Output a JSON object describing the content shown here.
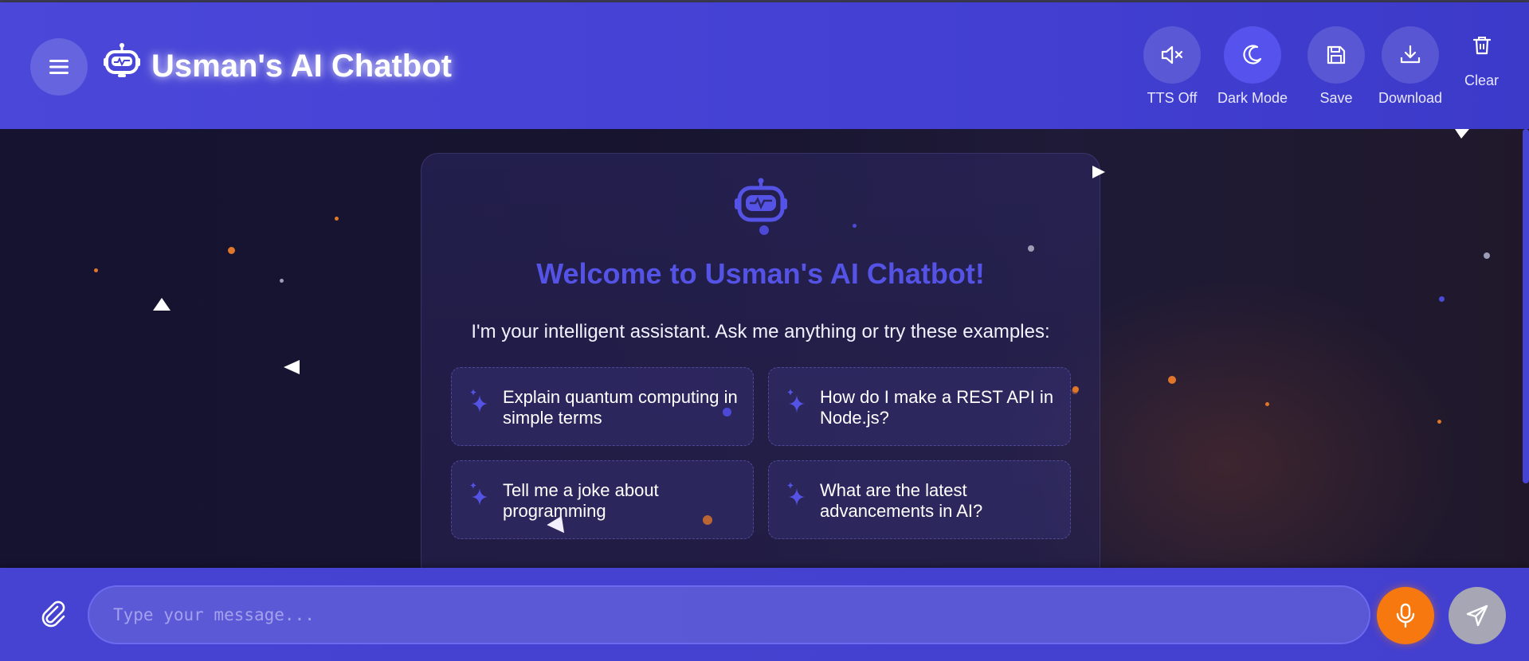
{
  "header": {
    "title": "Usman's AI Chatbot",
    "menu_icon": "hamburger-menu-icon",
    "logo_icon": "robot-icon",
    "toolbar": [
      {
        "label": "TTS Off",
        "icon": "speaker-muted-icon",
        "active": false
      },
      {
        "label": "Dark Mode",
        "icon": "moon-icon",
        "active": true
      },
      {
        "label": "Save",
        "icon": "floppy-disk-icon",
        "active": false
      },
      {
        "label": "Download",
        "icon": "download-icon",
        "active": false
      },
      {
        "label": "Clear",
        "icon": "trash-icon",
        "active": false
      }
    ]
  },
  "welcome": {
    "icon": "robot-icon",
    "title": "Welcome to Usman's AI Chatbot!",
    "subtitle": "I'm your intelligent assistant. Ask me anything or try these examples:",
    "suggestions": [
      {
        "text": "Explain quantum computing in simple terms",
        "icon": "sparkles-icon"
      },
      {
        "text": "How do I make a REST API in Node.js?",
        "icon": "sparkles-icon"
      },
      {
        "text": "Tell me a joke about programming",
        "icon": "sparkles-icon"
      },
      {
        "text": "What are the latest advancements in AI?",
        "icon": "sparkles-icon"
      }
    ]
  },
  "composer": {
    "placeholder": "Type your message...",
    "value": "",
    "attach_icon": "paperclip-icon",
    "mic_icon": "microphone-icon",
    "send_icon": "send-icon"
  },
  "colors": {
    "header_bg": "#4643d2",
    "accent": "#5553e6",
    "mic": "#f6780f",
    "send_disabled": "#a6a6b4",
    "background": "#161331"
  }
}
